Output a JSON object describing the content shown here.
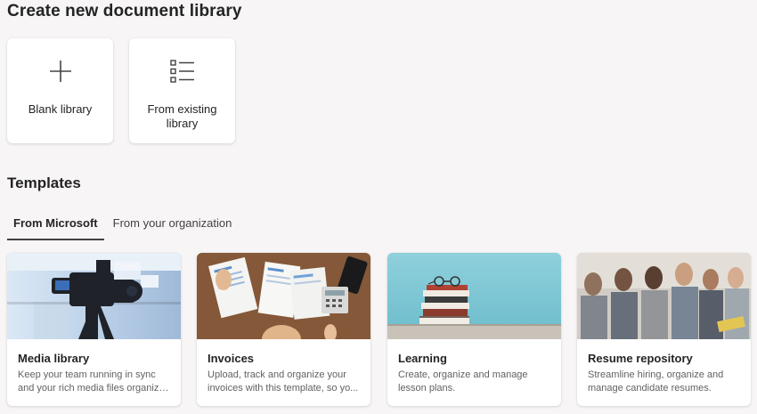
{
  "header": {
    "title": "Create new document library"
  },
  "create_options": [
    {
      "label": "Blank library",
      "icon": "plus-icon"
    },
    {
      "label": "From existing library",
      "icon": "list-icon"
    }
  ],
  "templates": {
    "title": "Templates",
    "tabs": [
      {
        "label": "From Microsoft",
        "active": true
      },
      {
        "label": "From your organization",
        "active": false
      }
    ],
    "cards": [
      {
        "name": "Media library",
        "desc_line1": "Keep your team running in sync",
        "desc_line2": "and your rich media files organize..."
      },
      {
        "name": "Invoices",
        "desc_line1": "Upload, track and organize your",
        "desc_line2": "invoices with this template, so yo..."
      },
      {
        "name": "Learning",
        "desc_line1": "Create, organize and manage",
        "desc_line2": "lesson plans."
      },
      {
        "name": "Resume repository",
        "desc_line1": "Streamline hiring, organize and",
        "desc_line2": "manage candidate resumes."
      }
    ]
  },
  "colors": {
    "background": "#f7f5f5",
    "card": "#ffffff",
    "text_primary": "#242424",
    "text_secondary": "#616161",
    "tab_indicator": "#424242"
  }
}
